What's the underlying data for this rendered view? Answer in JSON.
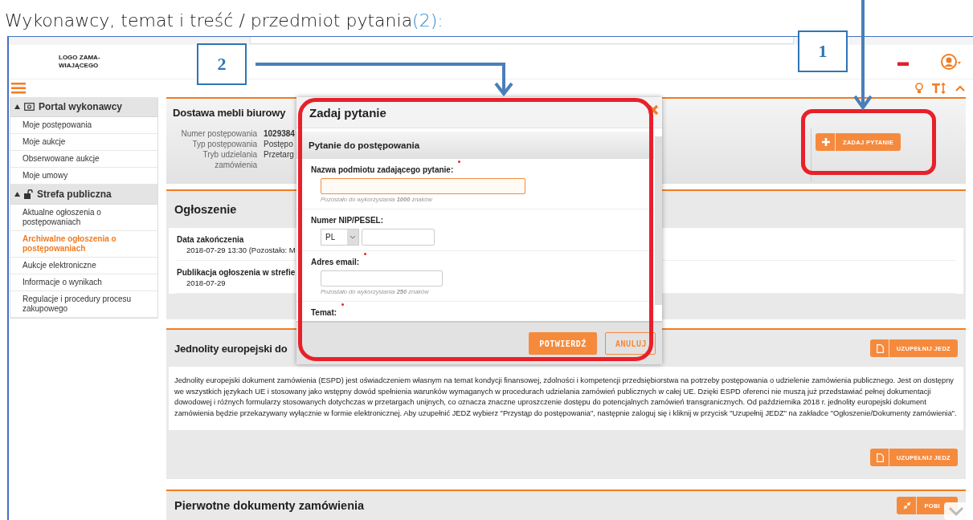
{
  "caption": {
    "text": "Wykonawcy, temat i treść / przedmiot pytania",
    "marker": "(2):"
  },
  "callouts": [
    {
      "label": "2"
    },
    {
      "label": "1"
    }
  ],
  "header": {
    "logo_lines": [
      "LOGO ZAMA-",
      "WIAJĄCEGO"
    ]
  },
  "sidebar": {
    "sections": [
      {
        "title": "Portal wykonawcy",
        "expanded": true,
        "items": [
          {
            "label": "Moje postępowania",
            "selected": false
          },
          {
            "label": "Moje aukcje",
            "selected": false
          },
          {
            "label": "Obserwowane aukcje",
            "selected": false
          },
          {
            "label": "Moje umowy",
            "selected": false
          }
        ]
      },
      {
        "title": "Strefa publiczna",
        "expanded": true,
        "items": [
          {
            "label": "Aktualne ogłoszenia o postępowaniach",
            "selected": false
          },
          {
            "label": "Archiwalne ogłoszenia o postępowaniach",
            "selected": true
          },
          {
            "label": "Aukcje elektroniczne",
            "selected": false
          },
          {
            "label": "Informacje o wynikach",
            "selected": false
          },
          {
            "label": "Regulacje i procedury procesu zakupowego",
            "selected": false
          }
        ]
      }
    ]
  },
  "procedure": {
    "title": "Dostawa mebli biurowy",
    "details": [
      {
        "label": "Numer postępowania",
        "value": "1029384",
        "bold": true
      },
      {
        "label": "Typ postępowania",
        "value": "Postępo",
        "bold": false
      },
      {
        "label": "Tryb udzielania zamówienia",
        "value": "Przetarg",
        "bold": false
      }
    ],
    "ask_button": "ZADAJ PYTANIE"
  },
  "notice": {
    "title": "Ogłoszenie",
    "fields": [
      {
        "label": "Data zakończenia",
        "value": "2018-07-29 13:30 (Pozostało: M"
      },
      {
        "label": "Publikacja ogłoszenia w strefie",
        "value": "2018-07-29"
      }
    ]
  },
  "jedz": {
    "title": "Jednolity europejski do",
    "button": "UZUPEŁNIJ JEDZ",
    "text": "Jednolity europejski dokument zamówienia (ESPD) jest oświadczeniem własnym na temat kondycji finansowej, zdolności i kompetencji przedsiębiorstwa na potrzeby postępowania o udzielenie zamówienia publicznego. Jest on dostępny we wszystkich językach UE i stosowany jako wstępny dowód spełnienia warunków wymaganych w procedurach udzielania zamówień publicznych w całej UE. Dzięki ESPD oferenci nie muszą już przedstawiać pełnej dokumentacji dowodowej i różnych formularzy stosowanych dotychczas w przetargach unijnych, co oznacza znaczne uproszczenie dostępu do potencjalnych zamówień transgranicznych. Od października 2018 r. jednolity europejski dokument zamówienia będzie przekazywany wyłącznie w formie elektronicznej. Aby uzupełnić JEDZ wybierz \"Przystąp do postępowania\", następnie zaloguj się i kliknij w przycisk \"Uzupełnij JEDZ\" na zakładce \"Ogłoszenie/Dokumenty zamówienia\".",
    "footer_button": "UZUPEŁNIJ JEDZ"
  },
  "documents": {
    "title": "Pierwotne dokumenty zamówienia",
    "button": "POBI"
  },
  "modal": {
    "title": "Zadaj pytanie",
    "section": "Pytanie do postępowania",
    "fields": [
      {
        "kind": "name",
        "label": "Nazwa podmiotu zadającego pytanie:",
        "required": true,
        "focused": true,
        "hint": "Pozostało do wykorzystania **1000** znaków"
      },
      {
        "kind": "nip",
        "label": "Numer NIP/PESEL:",
        "required": false,
        "focused": false,
        "country": "PL"
      },
      {
        "kind": "email",
        "label": "Adres email:",
        "required": true,
        "focused": false,
        "hint": "Pozostało do wykorzystania **250** znaków"
      },
      {
        "kind": "label",
        "label": "Temat:",
        "required": true
      }
    ],
    "buttons": [
      {
        "label": "POTWIERDŹ",
        "kind": "primary"
      },
      {
        "label": "ANULUJ",
        "kind": "secondary"
      }
    ]
  }
}
